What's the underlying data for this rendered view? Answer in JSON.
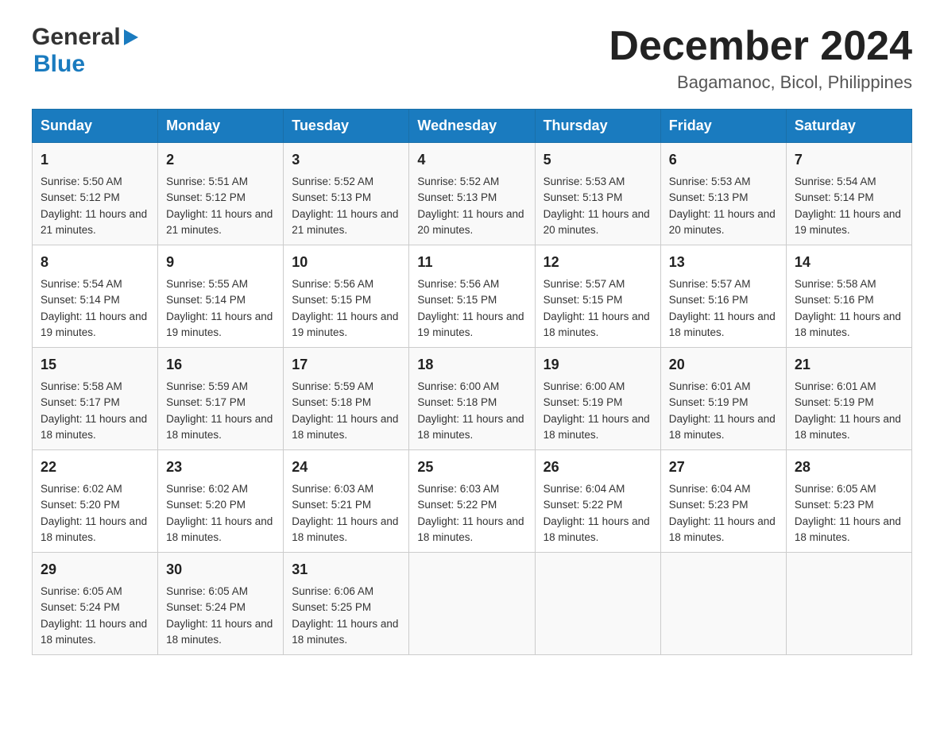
{
  "header": {
    "logo_general": "General",
    "logo_blue": "Blue",
    "month_title": "December 2024",
    "location": "Bagamanoc, Bicol, Philippines"
  },
  "calendar": {
    "days_of_week": [
      "Sunday",
      "Monday",
      "Tuesday",
      "Wednesday",
      "Thursday",
      "Friday",
      "Saturday"
    ],
    "weeks": [
      [
        {
          "day": "1",
          "sunrise": "Sunrise: 5:50 AM",
          "sunset": "Sunset: 5:12 PM",
          "daylight": "Daylight: 11 hours and 21 minutes."
        },
        {
          "day": "2",
          "sunrise": "Sunrise: 5:51 AM",
          "sunset": "Sunset: 5:12 PM",
          "daylight": "Daylight: 11 hours and 21 minutes."
        },
        {
          "day": "3",
          "sunrise": "Sunrise: 5:52 AM",
          "sunset": "Sunset: 5:13 PM",
          "daylight": "Daylight: 11 hours and 21 minutes."
        },
        {
          "day": "4",
          "sunrise": "Sunrise: 5:52 AM",
          "sunset": "Sunset: 5:13 PM",
          "daylight": "Daylight: 11 hours and 20 minutes."
        },
        {
          "day": "5",
          "sunrise": "Sunrise: 5:53 AM",
          "sunset": "Sunset: 5:13 PM",
          "daylight": "Daylight: 11 hours and 20 minutes."
        },
        {
          "day": "6",
          "sunrise": "Sunrise: 5:53 AM",
          "sunset": "Sunset: 5:13 PM",
          "daylight": "Daylight: 11 hours and 20 minutes."
        },
        {
          "day": "7",
          "sunrise": "Sunrise: 5:54 AM",
          "sunset": "Sunset: 5:14 PM",
          "daylight": "Daylight: 11 hours and 19 minutes."
        }
      ],
      [
        {
          "day": "8",
          "sunrise": "Sunrise: 5:54 AM",
          "sunset": "Sunset: 5:14 PM",
          "daylight": "Daylight: 11 hours and 19 minutes."
        },
        {
          "day": "9",
          "sunrise": "Sunrise: 5:55 AM",
          "sunset": "Sunset: 5:14 PM",
          "daylight": "Daylight: 11 hours and 19 minutes."
        },
        {
          "day": "10",
          "sunrise": "Sunrise: 5:56 AM",
          "sunset": "Sunset: 5:15 PM",
          "daylight": "Daylight: 11 hours and 19 minutes."
        },
        {
          "day": "11",
          "sunrise": "Sunrise: 5:56 AM",
          "sunset": "Sunset: 5:15 PM",
          "daylight": "Daylight: 11 hours and 19 minutes."
        },
        {
          "day": "12",
          "sunrise": "Sunrise: 5:57 AM",
          "sunset": "Sunset: 5:15 PM",
          "daylight": "Daylight: 11 hours and 18 minutes."
        },
        {
          "day": "13",
          "sunrise": "Sunrise: 5:57 AM",
          "sunset": "Sunset: 5:16 PM",
          "daylight": "Daylight: 11 hours and 18 minutes."
        },
        {
          "day": "14",
          "sunrise": "Sunrise: 5:58 AM",
          "sunset": "Sunset: 5:16 PM",
          "daylight": "Daylight: 11 hours and 18 minutes."
        }
      ],
      [
        {
          "day": "15",
          "sunrise": "Sunrise: 5:58 AM",
          "sunset": "Sunset: 5:17 PM",
          "daylight": "Daylight: 11 hours and 18 minutes."
        },
        {
          "day": "16",
          "sunrise": "Sunrise: 5:59 AM",
          "sunset": "Sunset: 5:17 PM",
          "daylight": "Daylight: 11 hours and 18 minutes."
        },
        {
          "day": "17",
          "sunrise": "Sunrise: 5:59 AM",
          "sunset": "Sunset: 5:18 PM",
          "daylight": "Daylight: 11 hours and 18 minutes."
        },
        {
          "day": "18",
          "sunrise": "Sunrise: 6:00 AM",
          "sunset": "Sunset: 5:18 PM",
          "daylight": "Daylight: 11 hours and 18 minutes."
        },
        {
          "day": "19",
          "sunrise": "Sunrise: 6:00 AM",
          "sunset": "Sunset: 5:19 PM",
          "daylight": "Daylight: 11 hours and 18 minutes."
        },
        {
          "day": "20",
          "sunrise": "Sunrise: 6:01 AM",
          "sunset": "Sunset: 5:19 PM",
          "daylight": "Daylight: 11 hours and 18 minutes."
        },
        {
          "day": "21",
          "sunrise": "Sunrise: 6:01 AM",
          "sunset": "Sunset: 5:19 PM",
          "daylight": "Daylight: 11 hours and 18 minutes."
        }
      ],
      [
        {
          "day": "22",
          "sunrise": "Sunrise: 6:02 AM",
          "sunset": "Sunset: 5:20 PM",
          "daylight": "Daylight: 11 hours and 18 minutes."
        },
        {
          "day": "23",
          "sunrise": "Sunrise: 6:02 AM",
          "sunset": "Sunset: 5:20 PM",
          "daylight": "Daylight: 11 hours and 18 minutes."
        },
        {
          "day": "24",
          "sunrise": "Sunrise: 6:03 AM",
          "sunset": "Sunset: 5:21 PM",
          "daylight": "Daylight: 11 hours and 18 minutes."
        },
        {
          "day": "25",
          "sunrise": "Sunrise: 6:03 AM",
          "sunset": "Sunset: 5:22 PM",
          "daylight": "Daylight: 11 hours and 18 minutes."
        },
        {
          "day": "26",
          "sunrise": "Sunrise: 6:04 AM",
          "sunset": "Sunset: 5:22 PM",
          "daylight": "Daylight: 11 hours and 18 minutes."
        },
        {
          "day": "27",
          "sunrise": "Sunrise: 6:04 AM",
          "sunset": "Sunset: 5:23 PM",
          "daylight": "Daylight: 11 hours and 18 minutes."
        },
        {
          "day": "28",
          "sunrise": "Sunrise: 6:05 AM",
          "sunset": "Sunset: 5:23 PM",
          "daylight": "Daylight: 11 hours and 18 minutes."
        }
      ],
      [
        {
          "day": "29",
          "sunrise": "Sunrise: 6:05 AM",
          "sunset": "Sunset: 5:24 PM",
          "daylight": "Daylight: 11 hours and 18 minutes."
        },
        {
          "day": "30",
          "sunrise": "Sunrise: 6:05 AM",
          "sunset": "Sunset: 5:24 PM",
          "daylight": "Daylight: 11 hours and 18 minutes."
        },
        {
          "day": "31",
          "sunrise": "Sunrise: 6:06 AM",
          "sunset": "Sunset: 5:25 PM",
          "daylight": "Daylight: 11 hours and 18 minutes."
        },
        null,
        null,
        null,
        null
      ]
    ]
  }
}
